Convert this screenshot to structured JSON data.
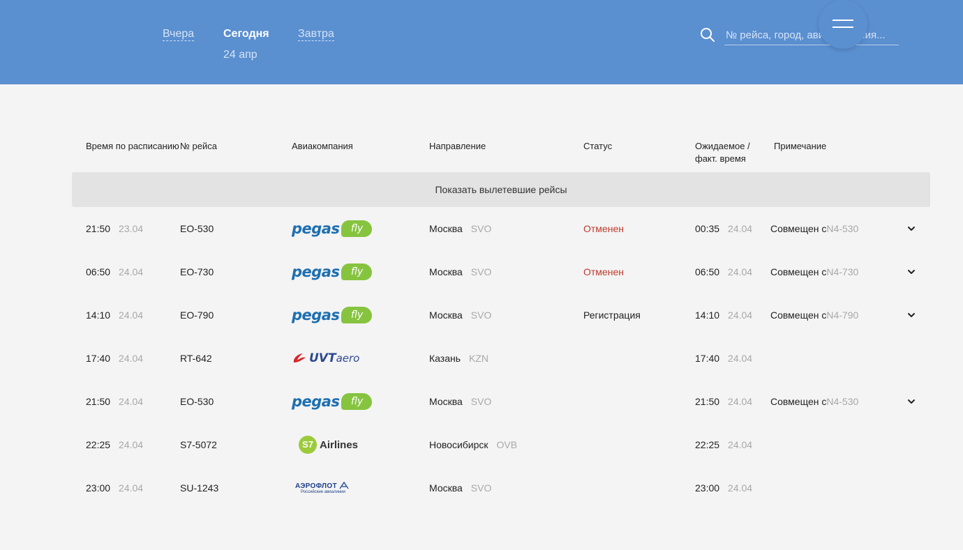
{
  "nav": {
    "yesterday": "Вчера",
    "today": "Сегодня",
    "tomorrow": "Завтра",
    "today_date": "24 апр"
  },
  "search": {
    "placeholder": "№ рейса, город, авиакомпания..."
  },
  "table": {
    "headers": {
      "scheduled": "Время по расписанию",
      "flight": "№ рейса",
      "airline": "Авиакомпания",
      "direction": "Направление",
      "status": "Статус",
      "actual": "Ожидаемое / факт. время",
      "note": "Примечание"
    },
    "show_departed": "Показать вылетевшие рейсы",
    "rows": [
      {
        "time": "21:50",
        "date": "23.04",
        "flight": "EO-530",
        "airline": "pegas",
        "city": "Москва",
        "code": "SVO",
        "status": "Отменен",
        "status_type": "cancel",
        "actual_time": "00:35",
        "actual_date": "24.04",
        "note": "Совмещен с ",
        "note_flight": "N4-530",
        "expandable": true
      },
      {
        "time": "06:50",
        "date": "24.04",
        "flight": "EO-730",
        "airline": "pegas",
        "city": "Москва",
        "code": "SVO",
        "status": "Отменен",
        "status_type": "cancel",
        "actual_time": "06:50",
        "actual_date": "24.04",
        "note": "Совмещен с ",
        "note_flight": "N4-730",
        "expandable": true
      },
      {
        "time": "14:10",
        "date": "24.04",
        "flight": "EO-790",
        "airline": "pegas",
        "city": "Москва",
        "code": "SVO",
        "status": "Регистрация",
        "status_type": "normal",
        "actual_time": "14:10",
        "actual_date": "24.04",
        "note": "Совмещен с ",
        "note_flight": "N4-790",
        "expandable": true
      },
      {
        "time": "17:40",
        "date": "24.04",
        "flight": "RT-642",
        "airline": "uvt",
        "city": "Казань",
        "code": "KZN",
        "status": "",
        "status_type": "normal",
        "actual_time": "17:40",
        "actual_date": "24.04",
        "note": "",
        "note_flight": "",
        "expandable": false
      },
      {
        "time": "21:50",
        "date": "24.04",
        "flight": "EO-530",
        "airline": "pegas",
        "city": "Москва",
        "code": "SVO",
        "status": "",
        "status_type": "normal",
        "actual_time": "21:50",
        "actual_date": "24.04",
        "note": "Совмещен с ",
        "note_flight": "N4-530",
        "expandable": true
      },
      {
        "time": "22:25",
        "date": "24.04",
        "flight": "S7-5072",
        "airline": "s7",
        "city": "Новосибирск",
        "code": "OVB",
        "status": "",
        "status_type": "normal",
        "actual_time": "22:25",
        "actual_date": "24.04",
        "note": "",
        "note_flight": "",
        "expandable": false
      },
      {
        "time": "23:00",
        "date": "24.04",
        "flight": "SU-1243",
        "airline": "aeroflot",
        "city": "Москва",
        "code": "SVO",
        "status": "",
        "status_type": "normal",
        "actual_time": "23:00",
        "actual_date": "24.04",
        "note": "",
        "note_flight": "",
        "expandable": false
      }
    ]
  },
  "logos": {
    "pegas": {
      "word": "pegas",
      "badge": "fly"
    },
    "uvt": {
      "main": "UVT",
      "suffix": "aero"
    },
    "s7": {
      "mark": "S7",
      "text": "Airlines"
    },
    "aeroflot": {
      "main": "АЭРОФЛОТ",
      "sub": "Российские авиалинии"
    }
  },
  "colors": {
    "header_bg": "#5a8fd0",
    "cancel": "#c0392b",
    "pegas_blue": "#1d6fb0",
    "pegas_green": "#86c440",
    "s7_green": "#9bcb3b"
  },
  "icons": {
    "search": "search-icon",
    "menu": "hamburger-icon",
    "expand": "chevron-down-icon"
  }
}
